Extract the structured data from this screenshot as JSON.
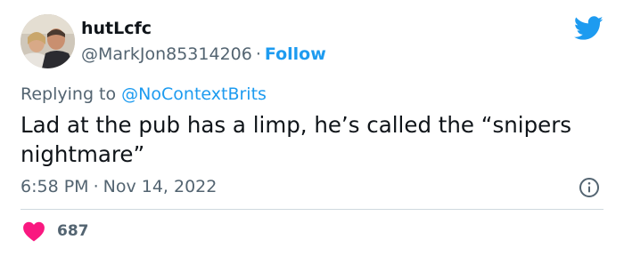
{
  "author": {
    "display_name": "hutLcfc",
    "handle": "@MarkJon85314206",
    "separator": "·",
    "follow_label": "Follow"
  },
  "reply": {
    "prefix": "Replying to",
    "mention": "@NoContextBrits"
  },
  "tweet": {
    "text": "Lad at the pub has a limp, he’s called the “snipers nightmare”"
  },
  "meta": {
    "time": "6:58 PM",
    "separator": "·",
    "date": "Nov 14, 2022"
  },
  "engagement": {
    "likes": "687"
  },
  "icons": {
    "brand": "twitter-bird-icon",
    "info": "info-icon",
    "like": "heart-icon"
  },
  "colors": {
    "accent": "#1d9bf0",
    "text": "#0f1419",
    "muted": "#536471",
    "like": "#f91880",
    "divider": "#cfd9de"
  }
}
